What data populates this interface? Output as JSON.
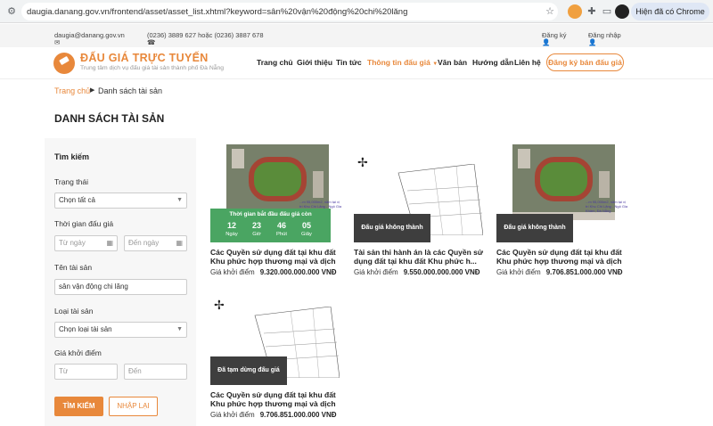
{
  "browser": {
    "url": "daugia.danang.gov.vn/frontend/asset/asset_list.xhtml?keyword=sân%20vận%20động%20chi%20lăng",
    "chrome_button": "Hiện đã có Chrome mới"
  },
  "topbar": {
    "email": "daugia@danang.gov.vn",
    "phone": "(0236) 3889 627 hoặc (0236) 3887 678",
    "register": "Đăng ký",
    "login": "Đăng nhập"
  },
  "header": {
    "logo_title": "ĐẤU GIÁ TRỰC TUYẾN",
    "logo_subtitle": "Trung tâm dịch vụ đấu giá tài sản thành phố Đà Nẵng",
    "menu": [
      "Trang chủ",
      "Giới thiệu",
      "Tin tức",
      "Thông tin đấu giá",
      "Văn bản",
      "Hướng dẫn",
      "Liên hệ"
    ],
    "register_button": "Đăng ký bán đấu giá"
  },
  "breadcrumb": {
    "home": "Trang chủ",
    "current": "Danh sách tài sản"
  },
  "page_title": "DANH SÁCH TÀI SẢN",
  "search": {
    "heading": "Tìm kiếm",
    "status_label": "Trạng thái",
    "status_value": "Chọn tất cả",
    "time_label": "Thời gian đấu giá",
    "from_date_placeholder": "Từ ngày",
    "to_date_placeholder": "Đến ngày",
    "name_label": "Tên tài sản",
    "name_value": "sân vận động chi lăng",
    "type_label": "Loại tài sản",
    "type_value": "Chọn loại tài sản",
    "price_label": "Giá khởi điểm",
    "price_from_placeholder": "Từ",
    "price_to_placeholder": "Đến",
    "search_button": "TÌM KIẾM",
    "reset_button": "NHẬP LẠI"
  },
  "price_label": "Giá khởi điểm",
  "assets": [
    {
      "title": "Các Quyền sử dụng đất tại khu đất Khu phức hợp thương mại và dịch vụ c...",
      "price": "9.320.000.000.000 VNĐ",
      "countdown": {
        "title": "Thời gian bắt đầu đấu giá còn",
        "days": "12",
        "hours": "23",
        "minutes": "46",
        "seconds": "05",
        "days_label": "Ngày",
        "hours_label": "Giờ",
        "minutes_label": "Phút",
        "seconds_label": "Giây"
      },
      "side_text": "...m 95,000m2, nằm tại vị trí Khu Chi Lăng - Ngô Gia Khảm, Đà Nẵng"
    },
    {
      "title": "Tài sản thi hành án là các Quyền sử dụng đất tại khu đất Khu phức h...",
      "price": "9.550.000.000.000 VNĐ",
      "status": "Đấu giá không thành"
    },
    {
      "title": "Các Quyền sử dụng đất tại khu đất Khu phức hợp thương mại và dịch vụ c...",
      "price": "9.706.851.000.000 VNĐ",
      "status": "Đấu giá không thành",
      "side_text": "...m 95,000m2, nằm tại vị trí Khu Chi Lăng - Ngô Gia Khảm, Đà Nẵng"
    },
    {
      "title": "Các Quyền sử dụng đất tại khu đất Khu phức hợp thương mại và dịch vụ c...",
      "price": "9.706.851.000.000 VNĐ",
      "status": "Đã tạm dừng đấu giá"
    }
  ],
  "colors": {
    "accent": "#e8883b",
    "countdown_green": "#4aa562",
    "badge_dark": "#3e3e3e"
  }
}
